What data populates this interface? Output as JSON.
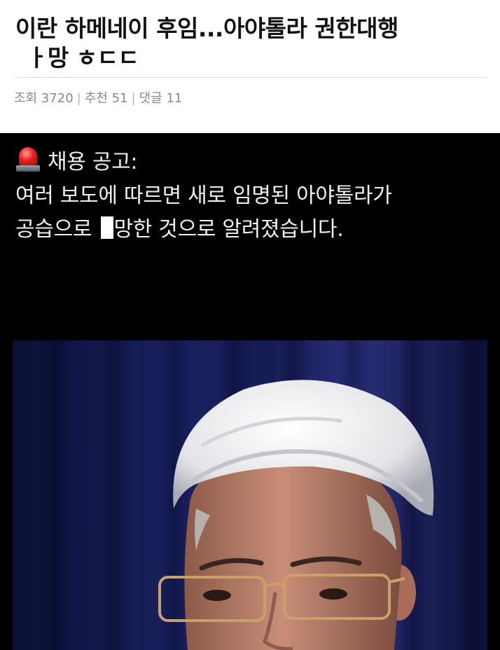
{
  "post": {
    "title_line1": "이란 하메네이 후임...아야톨라 권한대행",
    "title_line2": "ㅏ망 ㅎㄷㄷ"
  },
  "stats": {
    "views_label": "조회",
    "views": "3720",
    "likes_label": "추천",
    "likes": "51",
    "comments_label": "댓글",
    "comments": "11",
    "separator": "|"
  },
  "caption": {
    "heading": "채용 공고:",
    "line1": "여러 보도에 따르면 새로 임명된 아야톨라가",
    "line2_before": "공습으로 ",
    "line2_after": "망한 것으로 알려졌습니다."
  },
  "icons": {
    "siren": "police-siren-icon"
  }
}
